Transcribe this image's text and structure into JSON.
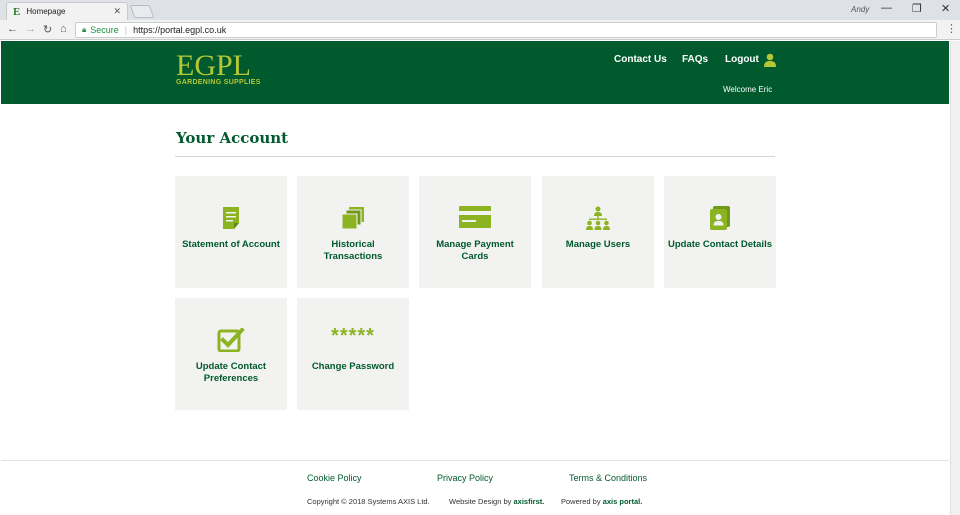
{
  "browser": {
    "tab_title": "Homepage",
    "tab_favicon": "E",
    "profile_name": "Andy",
    "secure_label": "Secure",
    "url": "https://portal.egpl.co.uk"
  },
  "header": {
    "logo_main": "EGPL",
    "logo_sub": "GARDENING SUPPLIES",
    "nav": {
      "contact": "Contact Us",
      "faqs": "FAQs",
      "logout": "Logout"
    },
    "welcome": "Welcome Eric"
  },
  "main": {
    "title": "Your Account",
    "tiles": [
      {
        "label": "Statement of Account",
        "icon": "document-icon"
      },
      {
        "label": "Historical Transactions",
        "icon": "stacked-documents-icon"
      },
      {
        "label": "Manage Payment Cards",
        "icon": "credit-card-icon"
      },
      {
        "label": "Manage Users",
        "icon": "users-hierarchy-icon"
      },
      {
        "label": "Update Contact Details",
        "icon": "contact-card-icon"
      },
      {
        "label": "Update Contact Preferences",
        "icon": "checkbox-icon"
      },
      {
        "label": "Change Password",
        "stars": "*****"
      }
    ]
  },
  "footer": {
    "links": [
      "Cookie Policy",
      "Privacy Policy",
      "Terms & Conditions"
    ],
    "copyright": "Copyright © 2018 Systems AXIS Ltd.",
    "design_prefix": "Website Design by",
    "design_brand": "axisfirst.",
    "powered_prefix": "Powered by",
    "powered_brand": "axis portal."
  },
  "colors": {
    "brand_green": "#005a2e",
    "accent_lime": "#8cb422",
    "tile_bg": "#f2f2f0"
  }
}
